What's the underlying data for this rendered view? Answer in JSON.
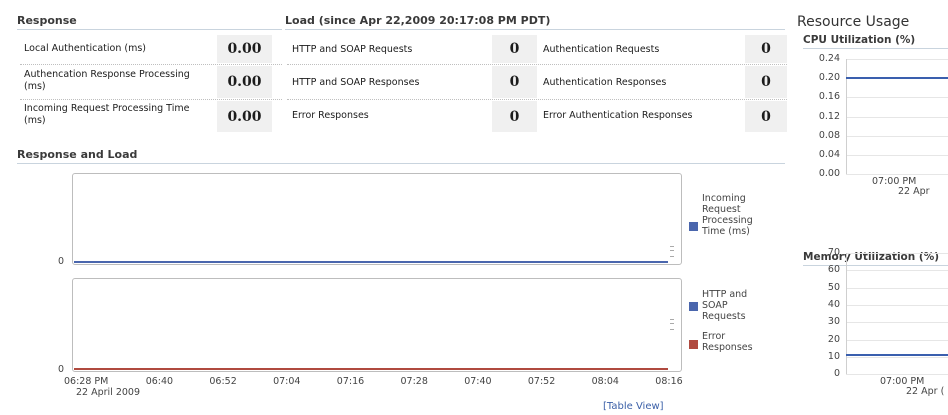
{
  "response": {
    "title": "Response",
    "rows": [
      {
        "label": "Local Authentication (ms)",
        "value": "0.00"
      },
      {
        "label": "Authencation Response Processing (ms)",
        "value": "0.00"
      },
      {
        "label": "Incoming Request Processing Time (ms)",
        "value": "0.00"
      }
    ]
  },
  "load": {
    "title": "Load (since Apr 22,2009 20:17:08 PM PDT)",
    "left_rows": [
      {
        "label": "HTTP and SOAP Requests",
        "value": "0"
      },
      {
        "label": "HTTP and SOAP Responses",
        "value": "0"
      },
      {
        "label": "Error Responses",
        "value": "0"
      }
    ],
    "right_rows": [
      {
        "label": "Authentication Requests",
        "value": "0"
      },
      {
        "label": "Authentication Responses",
        "value": "0"
      },
      {
        "label": "Error Authentication Responses",
        "value": "0"
      }
    ]
  },
  "response_and_load": {
    "title": "Response and Load",
    "top_chart": {
      "ytick": "0",
      "legend": [
        {
          "label": "Incoming Request Processing Time (ms)",
          "color": "#4a66ad"
        }
      ]
    },
    "bottom_chart": {
      "ytick": "0",
      "legend": [
        {
          "label": "HTTP and SOAP Requests",
          "color": "#4a66ad"
        },
        {
          "label": "Error Responses",
          "color": "#b04a3f"
        }
      ]
    },
    "x_ticks": [
      "06:28 PM",
      "06:40",
      "06:52",
      "07:04",
      "07:16",
      "07:28",
      "07:40",
      "07:52",
      "08:04",
      "08:16"
    ],
    "x_subtick": "22 April 2009",
    "table_view": "[Table View]"
  },
  "resource_usage": {
    "title": "Resource Usage",
    "cpu": {
      "title": "CPU Utilization (%)",
      "yticks": [
        "0.24",
        "0.20",
        "0.16",
        "0.12",
        "0.08",
        "0.04",
        "0.00"
      ],
      "x_tick": "07:00 PM",
      "x_subtick": "22 Apr",
      "color": "#3a5fae"
    },
    "memory": {
      "title": "Memory Utilization (%)",
      "yticks": [
        "70",
        "60",
        "50",
        "40",
        "30",
        "20",
        "10",
        "0"
      ],
      "x_tick": "07:00 PM",
      "x_subtick": "22 Apr (",
      "color": "#3a5fae"
    }
  },
  "chart_data": [
    {
      "type": "line",
      "title": "",
      "x": [
        "06:28 PM",
        "06:40",
        "06:52",
        "07:04",
        "07:16",
        "07:28",
        "07:40",
        "07:52",
        "08:04",
        "08:16"
      ],
      "series": [
        {
          "name": "Incoming Request Processing Time (ms)",
          "values": [
            0,
            0,
            0,
            0,
            0,
            0,
            0,
            0,
            0,
            0
          ]
        }
      ]
    },
    {
      "type": "line",
      "title": "",
      "x": [
        "06:28 PM",
        "06:40",
        "06:52",
        "07:04",
        "07:16",
        "07:28",
        "07:40",
        "07:52",
        "08:04",
        "08:16"
      ],
      "series": [
        {
          "name": "HTTP and SOAP Requests",
          "values": [
            0,
            0,
            0,
            0,
            0,
            0,
            0,
            0,
            0,
            0
          ]
        },
        {
          "name": "Error Responses",
          "values": [
            0,
            0,
            0,
            0,
            0,
            0,
            0,
            0,
            0,
            0
          ]
        }
      ]
    },
    {
      "type": "line",
      "title": "CPU Utilization (%)",
      "ylim": [
        0,
        0.24
      ],
      "series": [
        {
          "values": [
            0.2,
            0.2
          ]
        }
      ]
    },
    {
      "type": "line",
      "title": "Memory Utilization (%)",
      "ylim": [
        0,
        70
      ],
      "series": [
        {
          "values": [
            11,
            11
          ]
        }
      ]
    }
  ]
}
